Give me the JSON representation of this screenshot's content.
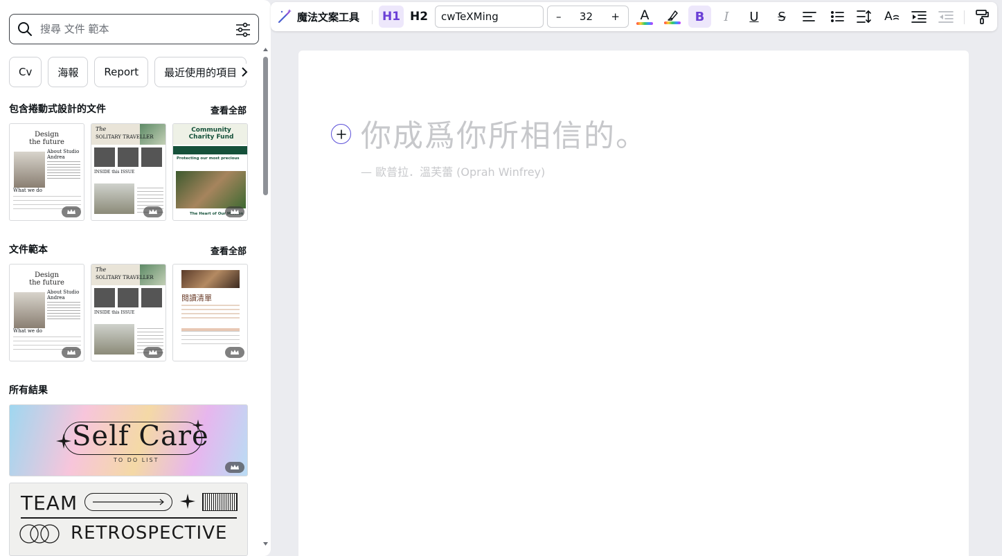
{
  "search": {
    "placeholder": "搜尋 文件 範本"
  },
  "chips": [
    "Cv",
    "海報",
    "Report",
    "最近使用的項目"
  ],
  "section_scroll": {
    "title": "包含捲動式設計的文件",
    "see_all": "查看全部"
  },
  "section_docs": {
    "title": "文件範本",
    "see_all": "查看全部"
  },
  "section_all": {
    "title": "所有結果"
  },
  "templates": {
    "design": {
      "line1": "Design",
      "line2": "the future",
      "about": "About Studio Andrea",
      "what": "What we do"
    },
    "traveller": {
      "title": "SOLITARY TRAVELLER",
      "the": "The",
      "inside": "INSIDE this ISSUE"
    },
    "charity": {
      "title": "Community Charity Fund",
      "sub": "Protecting our most precious",
      "footer": "The Heart of Our Mission"
    },
    "reading": {
      "title": "閱讀清單"
    }
  },
  "banners": {
    "selfcare": {
      "title": "Self Care",
      "sub": "TO DO LIST"
    },
    "retro": {
      "line1": "TEAM",
      "line2": "RETROSPECTIVE"
    }
  },
  "toolbar": {
    "magic": "魔法文案工具",
    "h1": "H1",
    "h2": "H2",
    "font": "cwTeXMing",
    "size": "32",
    "minus": "–",
    "plus": "+",
    "text_color_glyph": "A",
    "bold": "B",
    "italic": "I",
    "underline": "U",
    "strike": "S",
    "effects_glyph": "A"
  },
  "canvas": {
    "heading": "你成爲你所相信的。",
    "attribution": "— 歐普拉．溫芙蕾 (Oprah Winfrey)"
  },
  "colors": {
    "accent": "#6a3fd6",
    "bold_bg": "#ede7fb",
    "placeholder_text": "#c7c8cb",
    "charity_green": "#15513a"
  }
}
